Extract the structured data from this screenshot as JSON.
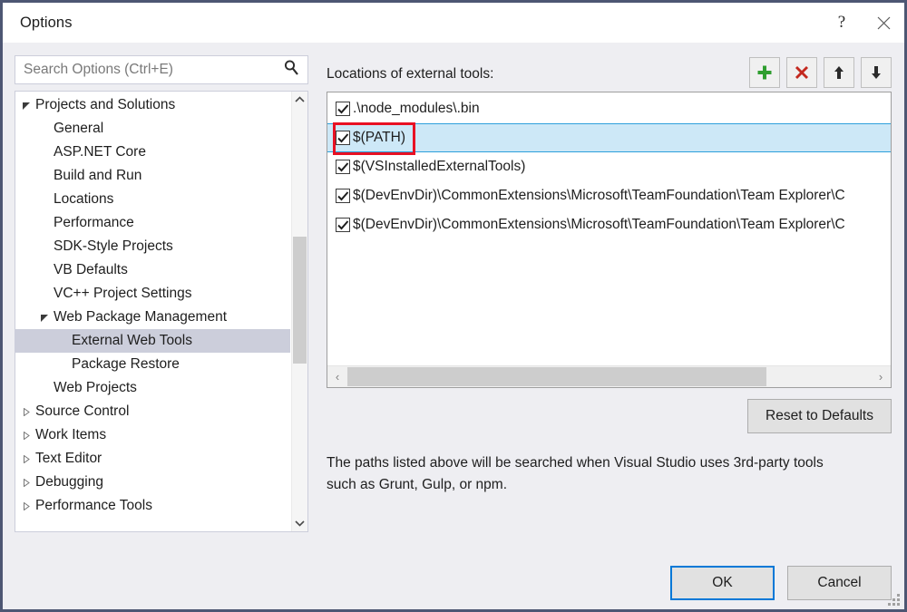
{
  "window": {
    "title": "Options",
    "help_icon": "question-mark-icon",
    "close_icon": "close-icon"
  },
  "search": {
    "placeholder": "Search Options (Ctrl+E)",
    "value": "",
    "icon": "search-icon"
  },
  "tree": {
    "items": [
      {
        "label": "Projects and Solutions",
        "level": 0,
        "twisty": "expanded",
        "selected": false
      },
      {
        "label": "General",
        "level": 1,
        "twisty": "none",
        "selected": false
      },
      {
        "label": "ASP.NET Core",
        "level": 1,
        "twisty": "none",
        "selected": false
      },
      {
        "label": "Build and Run",
        "level": 1,
        "twisty": "none",
        "selected": false
      },
      {
        "label": "Locations",
        "level": 1,
        "twisty": "none",
        "selected": false
      },
      {
        "label": "Performance",
        "level": 1,
        "twisty": "none",
        "selected": false
      },
      {
        "label": "SDK-Style Projects",
        "level": 1,
        "twisty": "none",
        "selected": false
      },
      {
        "label": "VB Defaults",
        "level": 1,
        "twisty": "none",
        "selected": false
      },
      {
        "label": "VC++ Project Settings",
        "level": 1,
        "twisty": "none",
        "selected": false
      },
      {
        "label": "Web Package Management",
        "level": 1,
        "twisty": "expanded",
        "selected": false
      },
      {
        "label": "External Web Tools",
        "level": 2,
        "twisty": "none",
        "selected": true
      },
      {
        "label": "Package Restore",
        "level": 2,
        "twisty": "none",
        "selected": false
      },
      {
        "label": "Web Projects",
        "level": 1,
        "twisty": "none",
        "selected": false
      },
      {
        "label": "Source Control",
        "level": 0,
        "twisty": "collapsed",
        "selected": false
      },
      {
        "label": "Work Items",
        "level": 0,
        "twisty": "collapsed",
        "selected": false
      },
      {
        "label": "Text Editor",
        "level": 0,
        "twisty": "collapsed",
        "selected": false
      },
      {
        "label": "Debugging",
        "level": 0,
        "twisty": "collapsed",
        "selected": false
      },
      {
        "label": "Performance Tools",
        "level": 0,
        "twisty": "collapsed",
        "selected": false
      }
    ],
    "scroll_up_icon": "chevron-up-icon",
    "scroll_down_icon": "chevron-down-icon"
  },
  "main": {
    "list_label": "Locations of external tools:",
    "toolbar": [
      {
        "name": "add-button",
        "icon": "plus-icon",
        "color": "#2f9e2f"
      },
      {
        "name": "delete-button",
        "icon": "close-x-icon",
        "color": "#c3281e"
      },
      {
        "name": "move-up-button",
        "icon": "arrow-up-icon",
        "color": "#2b2b2b"
      },
      {
        "name": "move-down-button",
        "icon": "arrow-down-icon",
        "color": "#2b2b2b"
      }
    ],
    "list_items": [
      {
        "text": ".\\node_modules\\.bin",
        "checked": true,
        "selected": false
      },
      {
        "text": "$(PATH)",
        "checked": true,
        "selected": true
      },
      {
        "text": "$(VSInstalledExternalTools)",
        "checked": true,
        "selected": false
      },
      {
        "text": "$(DevEnvDir)\\CommonExtensions\\Microsoft\\TeamFoundation\\Team Explorer\\C",
        "checked": true,
        "selected": false
      },
      {
        "text": "$(DevEnvDir)\\CommonExtensions\\Microsoft\\TeamFoundation\\Team Explorer\\C",
        "checked": true,
        "selected": false
      }
    ],
    "hscroll_left_icon": "chevron-left-icon",
    "hscroll_right_icon": "chevron-right-icon",
    "reset_label": "Reset to Defaults",
    "help_text": "The paths listed above will be searched when Visual Studio uses 3rd-party tools such as Grunt, Gulp, or npm."
  },
  "footer": {
    "ok_label": "OK",
    "cancel_label": "Cancel"
  },
  "annotation": {
    "color": "#e81123",
    "target": "$(PATH)"
  }
}
